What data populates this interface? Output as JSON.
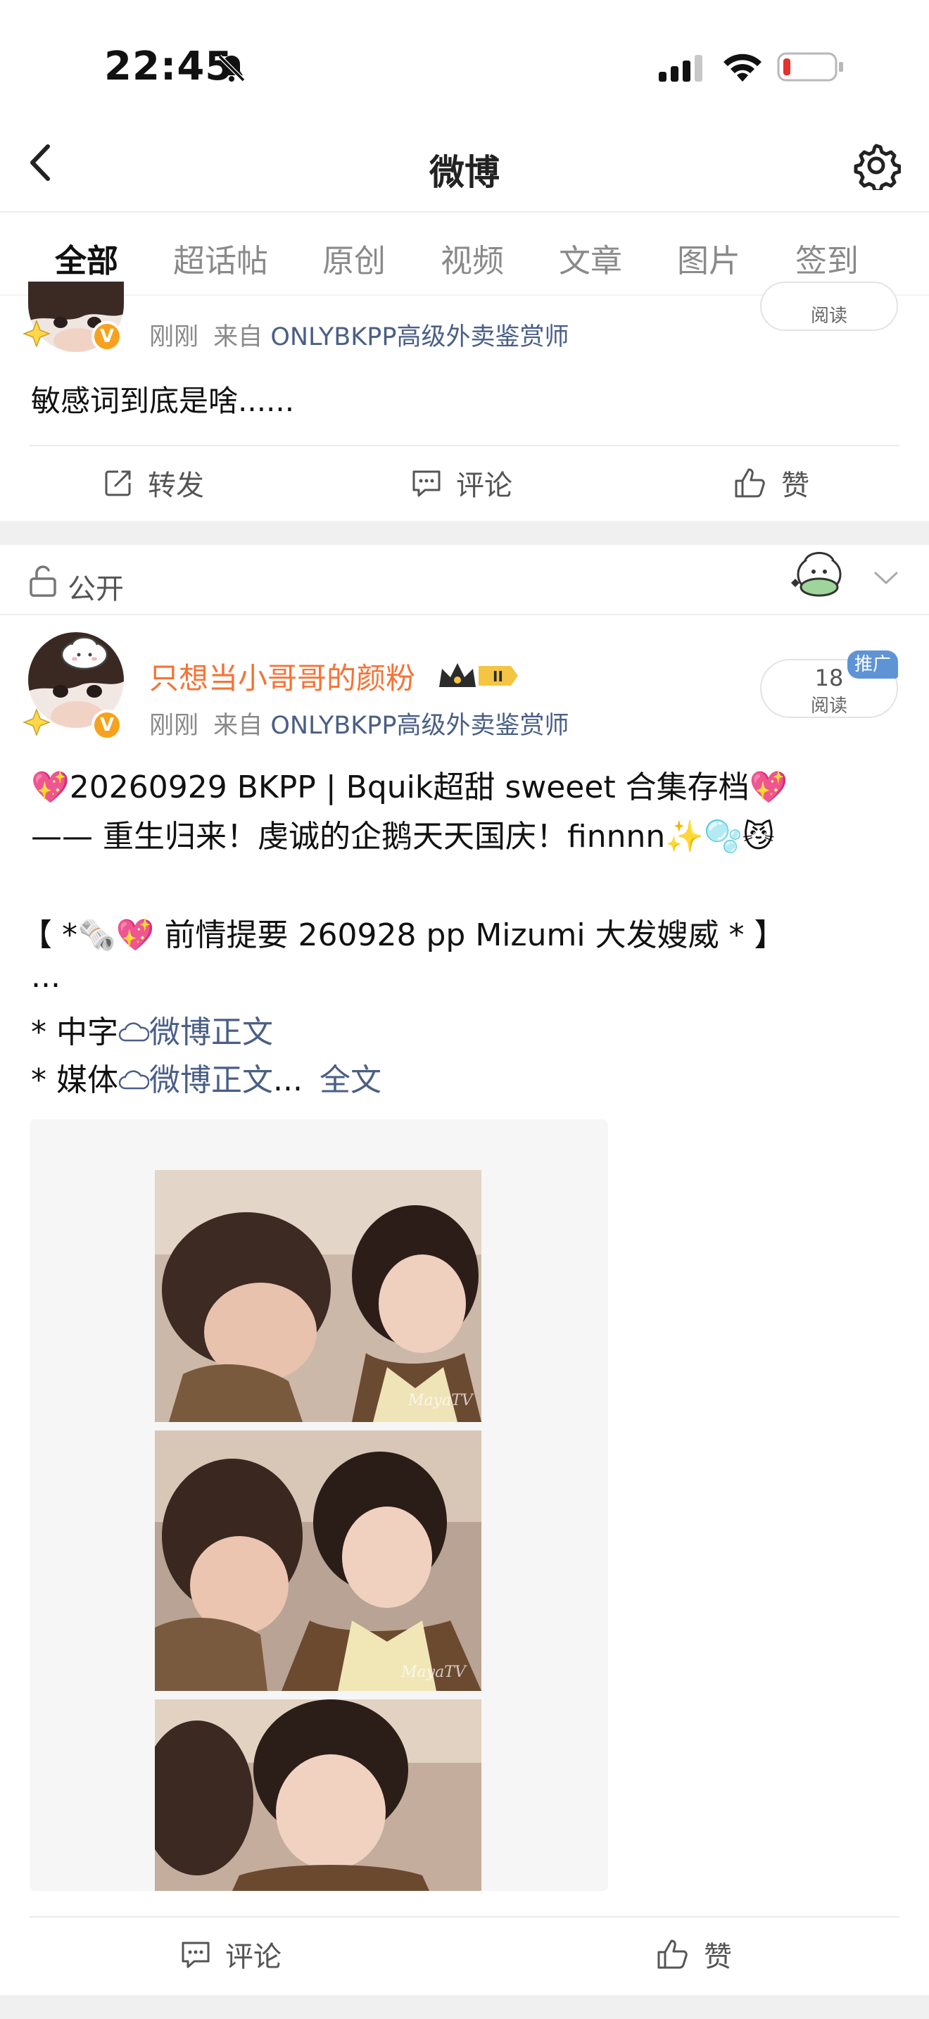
{
  "status_bar": {
    "time": "22:45"
  },
  "header": {
    "title": "微博"
  },
  "tabs": [
    {
      "label": "全部"
    },
    {
      "label": "超话帖"
    },
    {
      "label": "原创"
    },
    {
      "label": "视频"
    },
    {
      "label": "文章"
    },
    {
      "label": "图片"
    },
    {
      "label": "签到"
    }
  ],
  "post1": {
    "time": "刚刚",
    "source_prefix": "来自",
    "source": "ONLYBKPP高级外卖鉴赏师",
    "read_label": "阅读",
    "text": "敏感词到底是啥......",
    "actions": {
      "repost": "转发",
      "comment": "评论",
      "like": "赞"
    }
  },
  "visibility": {
    "label": "公开"
  },
  "post2": {
    "username": "只想当小哥哥的颜粉",
    "time": "刚刚",
    "source_prefix": "来自",
    "source": "ONLYBKPP高级外卖鉴赏师",
    "promo_tag": "推广",
    "read_count": "18",
    "read_label": "阅读",
    "line1": "💖20260929 BKPP | Bquik超甜 sweeet 合集存档💖",
    "line2": "—— 重生归来！虔诚的企鹅天天国庆！finnnn✨🫧😼",
    "line3": "【 *🗞️💖 前情提要 260928 pp Mizumi 大发嫂威 * 】",
    "line4": "...",
    "line5_prefix": "* 中字",
    "line5_link": "微博正文",
    "line6_prefix": "* 媒体",
    "line6_link": "微博正文",
    "line6_suffix": "...",
    "full_text": "全文",
    "watermark": "MayaTV",
    "actions": {
      "comment": "评论",
      "like": "赞"
    }
  },
  "colors": {
    "accent": "#ff8a33",
    "username": "#f77234",
    "link": "#4a5f86",
    "promo": "#5e94d6"
  }
}
